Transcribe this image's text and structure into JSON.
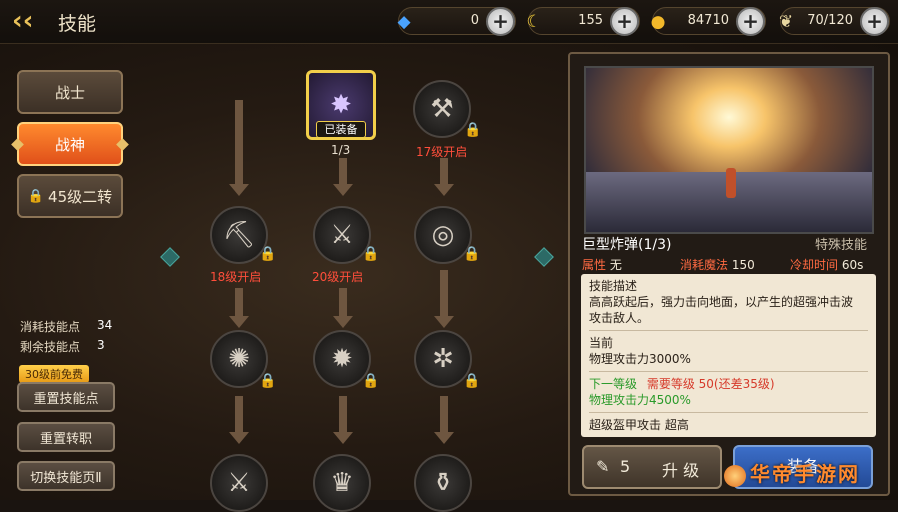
{
  "header": {
    "title": "技能",
    "resources": [
      {
        "icon": "diamond-icon",
        "glyph": "◆",
        "color": "#4aa3ff",
        "value": "0"
      },
      {
        "icon": "crescent-icon",
        "glyph": "☾",
        "color": "#f6d03a",
        "value": "155"
      },
      {
        "icon": "gold-coin-icon",
        "glyph": "●",
        "color": "#f2b82a",
        "value": "84710"
      },
      {
        "icon": "wing-stamina-icon",
        "glyph": "❦",
        "color": "#e8d6a0",
        "value": "70/120"
      }
    ]
  },
  "sidebar": {
    "classes": [
      {
        "label": "战士",
        "active": false
      },
      {
        "label": "战神",
        "active": true
      },
      {
        "label": "45级二转",
        "locked": true
      }
    ],
    "stats": [
      {
        "label": "消耗技能点",
        "value": "34"
      },
      {
        "label": "剩余技能点",
        "value": "3"
      }
    ],
    "free_tag": "30级前免费",
    "buttons": [
      "重置技能点",
      "重置转职",
      "切换技能页Ⅱ"
    ]
  },
  "tree": {
    "equipped_tag": "已装备",
    "nodes": [
      {
        "id": "r1c2",
        "glyph": "✸",
        "label": "1/3",
        "label_color": "white",
        "locked": false,
        "equipped": true
      },
      {
        "id": "r1c3",
        "glyph": "⚒",
        "label": "17级开启",
        "locked": true
      },
      {
        "id": "r2c1",
        "glyph": "⛏",
        "label": "18级开启",
        "locked": true
      },
      {
        "id": "r2c2",
        "glyph": "🪓",
        "label": "20级开启",
        "locked": true
      },
      {
        "id": "r2c3",
        "glyph": "◎",
        "label": "",
        "locked": true
      },
      {
        "id": "r3c1",
        "glyph": "✺",
        "label": "",
        "locked": true
      },
      {
        "id": "r3c2",
        "glyph": "✹",
        "label": "",
        "locked": true
      },
      {
        "id": "r3c3",
        "glyph": "✲",
        "label": "",
        "locked": true
      },
      {
        "id": "r4c1",
        "glyph": "⚔",
        "label": "",
        "locked": false
      },
      {
        "id": "r4c2",
        "glyph": "♛",
        "label": "",
        "locked": false
      },
      {
        "id": "r4c3",
        "glyph": "⚱",
        "label": "",
        "locked": false
      }
    ]
  },
  "detail": {
    "name": "巨型炸弹(1/3)",
    "type": "特殊技能",
    "attr_label": "属性",
    "attr_value": "无",
    "mana_label": "消耗魔法",
    "mana_value": "150",
    "cd_label": "冷却时间",
    "cd_value": "60s",
    "desc_title": "技能描述",
    "desc_lines": [
      "高高跃起后，强力击向地面，以产生的超强冲击波",
      "攻击敌人。"
    ],
    "current_title": "当前",
    "current_stat": "物理攻击力3000%",
    "next_title": "下一等级",
    "next_req": "需要等级 50(还差35级)",
    "next_stat": "物理攻击力4500%",
    "armor_line": "超级盔甲攻击  超高",
    "upgrade_cost": "5",
    "upgrade_label": "升 级",
    "equip_label": "装备"
  },
  "watermark": "华帝手游网"
}
